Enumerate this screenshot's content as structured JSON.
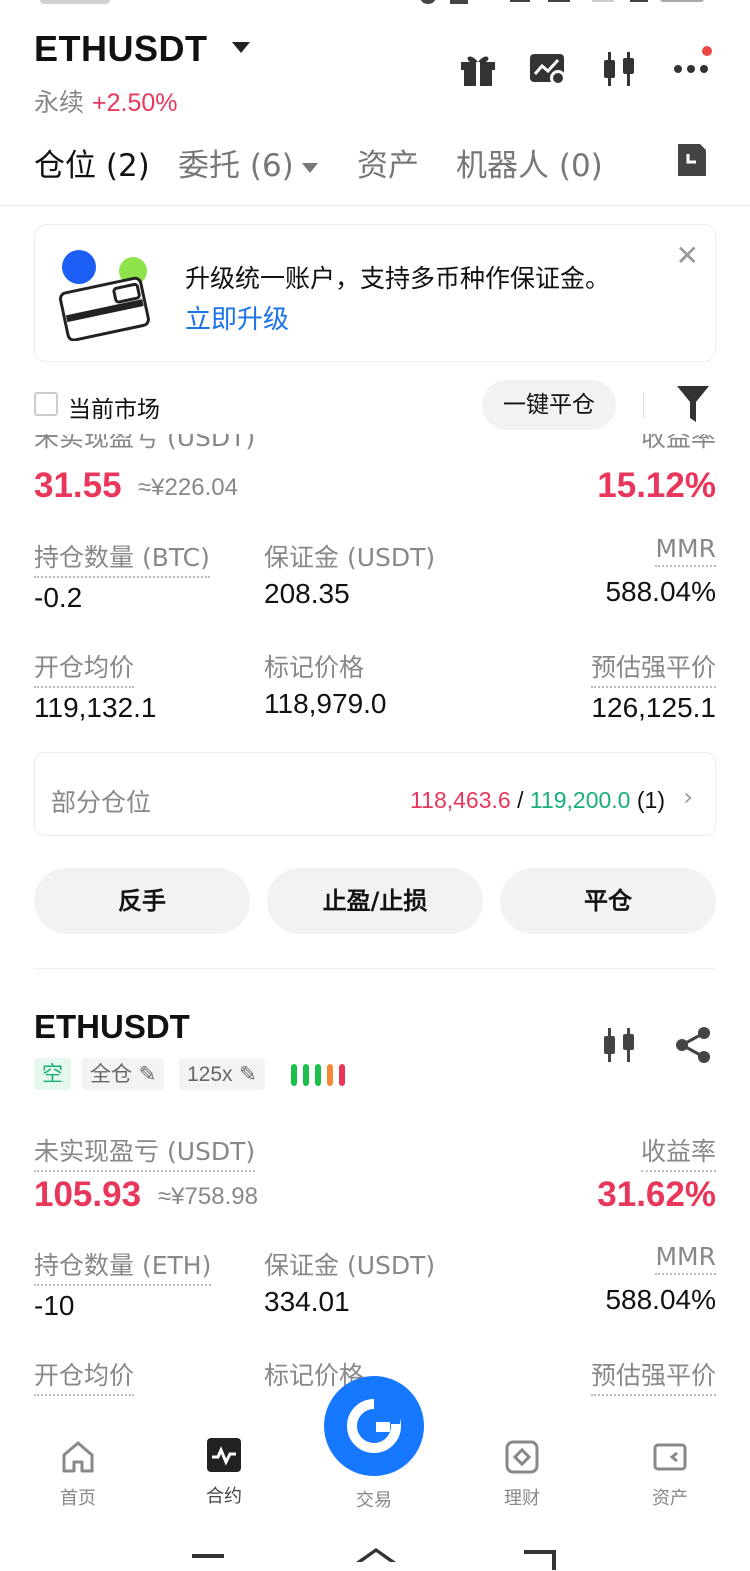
{
  "header": {
    "symbol": "ETHUSDT",
    "type": "永续",
    "change": "+2.50%"
  },
  "tabs": [
    {
      "label": "仓位 (2)"
    },
    {
      "label": "委托 (6)"
    },
    {
      "label": "资产"
    },
    {
      "label": "机器人 (0)"
    }
  ],
  "banner": {
    "text": "升级统一账户，支持多币种作保证金。",
    "link": "立即升级"
  },
  "filter": {
    "current_market": "当前市场",
    "close_all": "一键平仓"
  },
  "position1": {
    "pnl_label": "未实现盈亏 (USDT)",
    "pnl": "31.55",
    "pnl_cny": "≈¥226.04",
    "roe_label": "收益率",
    "roe": "15.12%",
    "size_label": "持仓数量 (BTC)",
    "size": "-0.2",
    "margin_label": "保证金 (USDT)",
    "margin": "208.35",
    "mmr_label": "MMR",
    "mmr": "588.04%",
    "entry_label": "开仓均价",
    "entry": "119,132.1",
    "mark_label": "标记价格",
    "mark": "118,979.0",
    "liq_label": "预估强平价",
    "liq": "126,125.1",
    "partial_label": "部分仓位",
    "partial_tp": "118,463.6",
    "partial_sep": "/",
    "partial_sl": "119,200.0",
    "partial_count": "(1)",
    "btn_reverse": "反手",
    "btn_tpsl": "止盈/止损",
    "btn_close": "平仓"
  },
  "position2": {
    "symbol": "ETHUSDT",
    "side": "空",
    "margin_mode": "全仓",
    "leverage": "125x",
    "pnl_label": "未实现盈亏 (USDT)",
    "pnl": "105.93",
    "pnl_cny": "≈¥758.98",
    "roe_label": "收益率",
    "roe": "31.62%",
    "size_label": "持仓数量 (ETH)",
    "size": "-10",
    "margin_label": "保证金 (USDT)",
    "margin": "334.01",
    "mmr_label": "MMR",
    "mmr": "588.04%",
    "entry_label": "开仓均价",
    "mark_label": "标记价格",
    "liq_label": "预估强平价"
  },
  "bottom_nav": [
    {
      "label": "首页",
      "icon": "home-icon"
    },
    {
      "label": "合约",
      "icon": "futures-icon"
    },
    {
      "label": "交易",
      "icon": "trade-icon"
    },
    {
      "label": "理财",
      "icon": "earn-icon"
    },
    {
      "label": "资产",
      "icon": "wallet-icon"
    }
  ],
  "colors": {
    "red": "#e8375a",
    "green": "#1aaf7a",
    "orange": "#f58a35",
    "blue": "#1677ff"
  }
}
